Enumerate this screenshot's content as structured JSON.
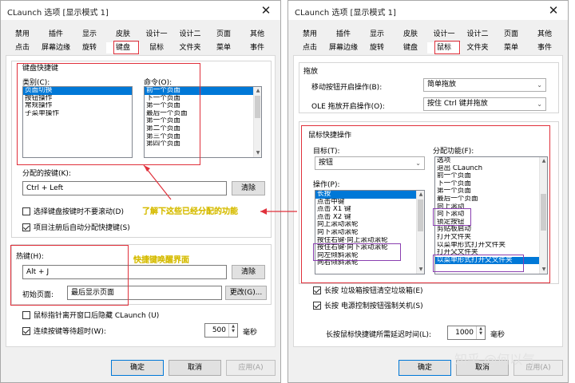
{
  "left": {
    "title": "CLaunch 选项 [显示模式 1]",
    "close": "✕",
    "tabs_row1": [
      "禁用",
      "插件",
      "显示",
      "皮肤",
      "设计一",
      "设计二",
      "页面",
      "其他"
    ],
    "tabs_row2": [
      "点击",
      "屏幕边缘",
      "旋转",
      "键盘",
      "鼠标",
      "文件夹",
      "菜单",
      "事件"
    ],
    "active_tab": "键盘",
    "group_title": "键盘快捷键",
    "category_label": "类别(C):",
    "categories": [
      "页面切换",
      "按钮操作",
      "常规操作",
      "子菜单操作"
    ],
    "command_label": "命令(O):",
    "commands": [
      "前一个页面",
      "下一个页面",
      "第一个页面",
      "最后一个页面",
      "第一个页面",
      "第二个页面",
      "第三个页面",
      "第四个页面"
    ],
    "assigned_label": "分配的按键(K):",
    "assigned_value": "Ctrl + Left",
    "clear_btn": "清除",
    "opt_scroll": "选择键盘按键时不要滚动(D)",
    "opt_autoassign": "项目注册后自动分配快捷键(S)",
    "hotkey_label": "热键(H):",
    "hotkey_value": "Alt + J",
    "clear_btn2": "清除",
    "init_page_label": "初始页面:",
    "init_page_value": "最后显示页面",
    "change_btn": "更改(G)...",
    "opt_close": "鼠标指针离开窗口后隐藏 CLaunch (U)",
    "opt_timeout": "连续按键等待超时(W):",
    "timeout_value": "500",
    "timeout_unit": "毫秒",
    "ok": "确定",
    "cancel": "取消",
    "apply": "应用(A)"
  },
  "right": {
    "title": "CLaunch 选项 [显示模式 1]",
    "close": "✕",
    "tabs_row1": [
      "禁用",
      "插件",
      "显示",
      "皮肤",
      "设计一",
      "设计二",
      "页面",
      "其他"
    ],
    "tabs_row2": [
      "点击",
      "屏幕边缘",
      "旋转",
      "键盘",
      "鼠标",
      "文件夹",
      "菜单",
      "事件"
    ],
    "active_tab": "鼠标",
    "drag_title": "拖放",
    "move_label": "移动按钮开启操作(B):",
    "move_value": "简单拖放",
    "ole_label": "OLE 拖放开启操作(O):",
    "ole_value": "按住 Ctrl 键并拖放",
    "shortcut_title": "鼠标快捷操作",
    "target_label": "目标(T):",
    "target_value": "按钮",
    "op_label": "操作(P):",
    "ops": [
      "长按",
      "点击中键",
      "点击 X1 键",
      "点击 X2 键",
      "向上滚动滚轮",
      "向下滚动滚轮",
      "按住右键·向上滚动滚轮",
      "按住右键·向下滚动滚轮",
      "向左倾斜滚轮",
      "向右倾斜滚轮"
    ],
    "func_label": "分配功能(F):",
    "funcs": [
      "选项",
      "退出 CLaunch",
      "前一个页面",
      "下一个页面",
      "第一个页面",
      "最后一个页面",
      "向上滚动",
      "向下滚动",
      "锁定按钮",
      "剪贴板启动",
      "打开文件夹",
      "以菜单形式打开文件夹",
      "打开父文件夹",
      "以菜单形式打开父文件夹"
    ],
    "opt_empty": "长按 垃圾箱按钮清空垃圾箱(E)",
    "opt_power": "长按 电源控制按钮强制关机(S)",
    "delay_label": "长按鼠标快捷键所需延迟时间(L):",
    "delay_value": "1000",
    "delay_unit": "毫秒",
    "ok": "确定",
    "cancel": "取消",
    "apply": "应用(A)"
  },
  "annotations": {
    "assigned_note": "了解下这些已经分配的功能",
    "hotkey_note": "快捷键唤醒界面"
  },
  "watermark": "知乎 @何以气",
  "colors": {
    "selection": "#0078d7",
    "annotation_box": "#e0303b",
    "highlight_box": "#8a3fb0",
    "annotation_text": "#d4b800"
  }
}
